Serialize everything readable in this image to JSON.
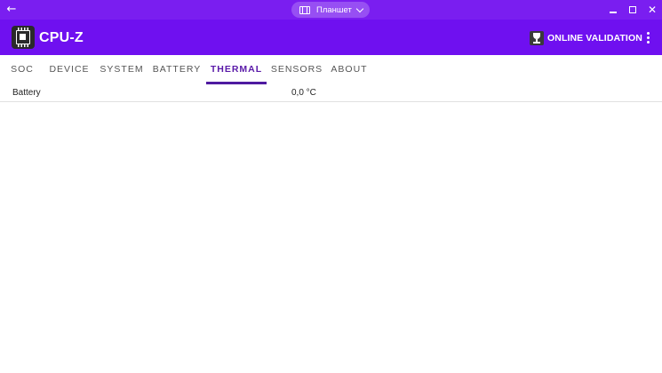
{
  "window": {
    "mode_label": "Планшет",
    "back_icon": "arrow-left-icon",
    "minimize_icon": "minimize-icon",
    "maximize_icon": "maximize-icon",
    "close_icon": "close-icon",
    "titlebar_color": "#7a1ef0"
  },
  "appbar": {
    "title": "CPU-Z",
    "logo_icon": "cpu-chip-icon",
    "validation_label": "ONLINE VALIDATION",
    "validation_icon": "trophy-icon",
    "menu_icon": "more-vert-icon",
    "color": "#6f10f0"
  },
  "tabs": [
    {
      "label": "SOC"
    },
    {
      "label": "DEVICE"
    },
    {
      "label": "SYSTEM"
    },
    {
      "label": "BATTERY"
    },
    {
      "label": "THERMAL"
    },
    {
      "label": "SENSORS"
    },
    {
      "label": "ABOUT"
    }
  ],
  "active_tab": "THERMAL",
  "accent_color": "#4f1aa0",
  "thermal": {
    "rows": [
      {
        "name": "Battery",
        "value": "0,0 °C"
      }
    ]
  }
}
